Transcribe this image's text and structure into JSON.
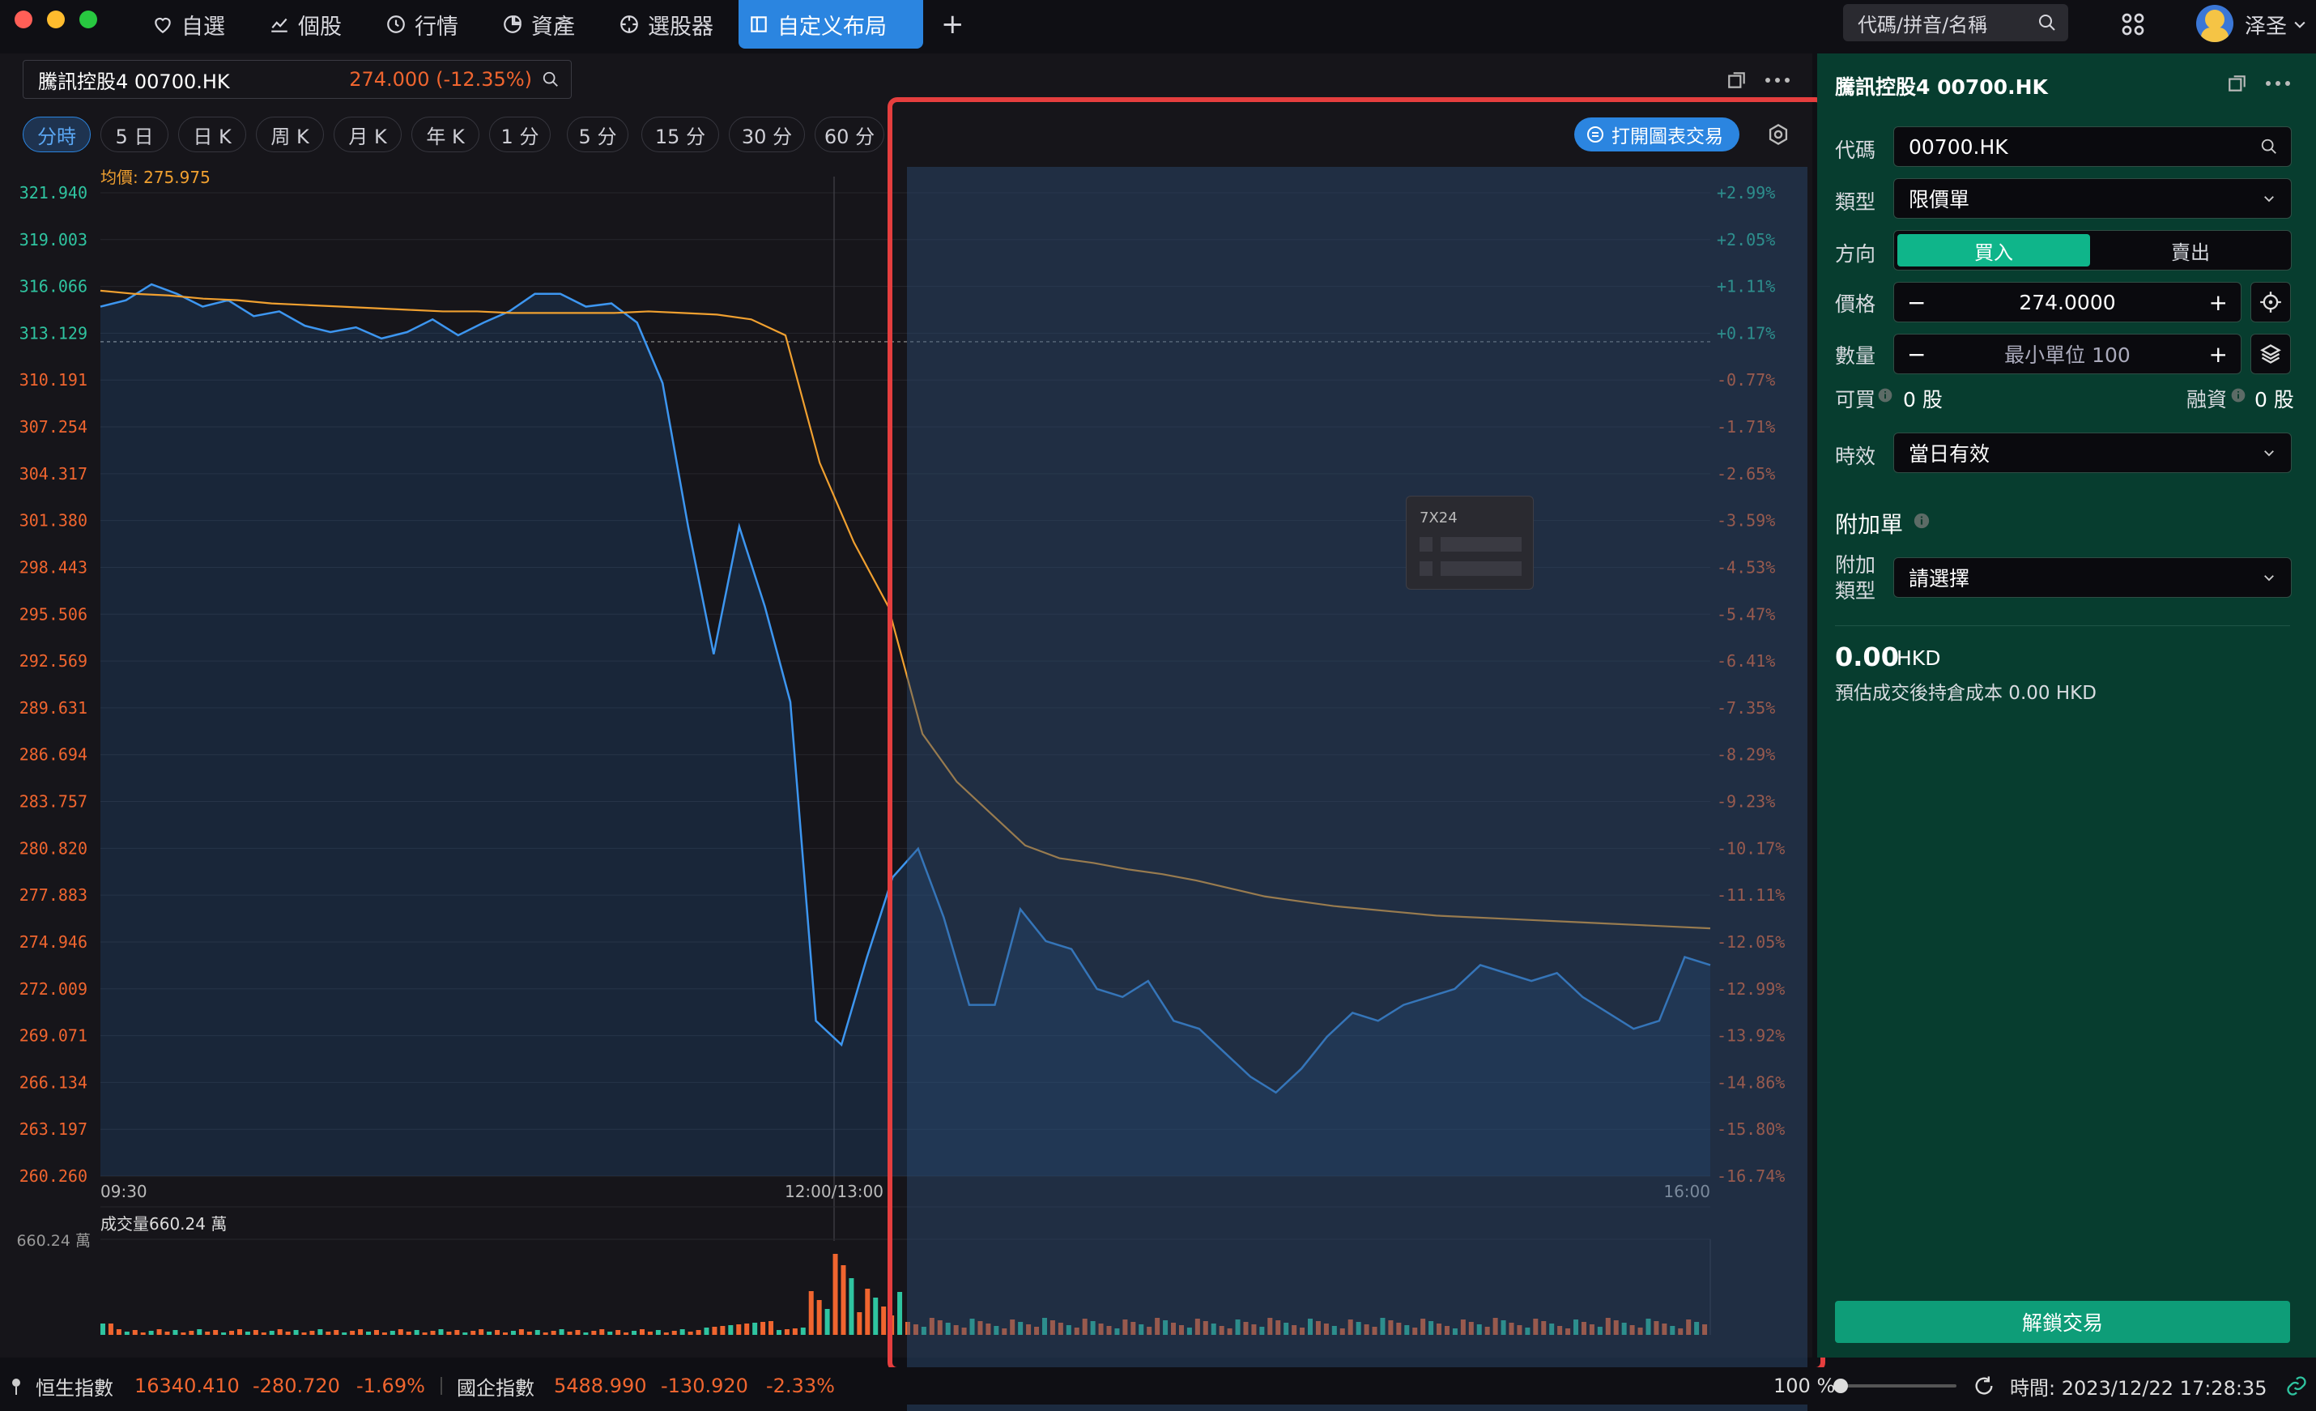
{
  "nav": {
    "tabs": [
      {
        "label": "自選"
      },
      {
        "label": "個股"
      },
      {
        "label": "行情"
      },
      {
        "label": "資產"
      },
      {
        "label": "選股器"
      },
      {
        "label": "自定义布局"
      }
    ],
    "add": "+",
    "search_placeholder": "代碼/拼音/名稱",
    "user": "泽圣"
  },
  "stock": {
    "name": "騰訊控股4 00700.HK",
    "price": "274.000 (-12.35%)"
  },
  "period_tabs": [
    "分時",
    "5 日",
    "日 K",
    "周 K",
    "月 K",
    "年 K",
    "1 分",
    "5 分",
    "15 分",
    "30 分",
    "60 分"
  ],
  "chart_data": {
    "type": "line",
    "avg_label": "均價: 275.975",
    "price_ticks": [
      "321.940",
      "319.003",
      "316.066",
      "313.129",
      "310.191",
      "307.254",
      "304.317",
      "301.380",
      "298.443",
      "295.506",
      "292.569",
      "289.631",
      "286.694",
      "283.757",
      "280.820",
      "277.883",
      "274.946",
      "272.009",
      "269.071",
      "266.134",
      "263.197",
      "260.260"
    ],
    "pct_ticks": [
      "+2.99%",
      "+2.05%",
      "+1.11%",
      "+0.17%",
      "-0.77%",
      "-1.71%",
      "-2.65%",
      "-3.59%",
      "-4.53%",
      "-5.47%",
      "-6.41%",
      "-7.35%",
      "-8.29%",
      "-9.23%",
      "-10.17%",
      "-11.11%",
      "-12.05%",
      "-12.99%",
      "-13.92%",
      "-14.86%",
      "-15.80%",
      "-16.74%"
    ],
    "x_ticks": [
      "09:30",
      "12:00/13:00",
      "16:00"
    ],
    "ylim": [
      260.26,
      321.94
    ],
    "prev_close": 312.6,
    "series": [
      {
        "name": "價格",
        "values": [
          314.8,
          315.2,
          316.2,
          315.6,
          314.8,
          315.2,
          314.2,
          314.5,
          313.6,
          313.2,
          313.5,
          312.8,
          313.2,
          314.0,
          313.0,
          313.8,
          314.5,
          315.6,
          315.6,
          314.8,
          315.0,
          313.8,
          310.0,
          301.0,
          293.0,
          301.0,
          296.0,
          290.0,
          270.0,
          268.5,
          274.0,
          279.0,
          280.8,
          276.5,
          271.0,
          271.0,
          277.0,
          275.0,
          274.5,
          272.0,
          271.5,
          272.5,
          270.0,
          269.5,
          268.0,
          266.5,
          265.5,
          267.0,
          269.0,
          270.5,
          270.0,
          271.0,
          271.5,
          272.0,
          273.5,
          273.0,
          272.5,
          273.0,
          271.5,
          270.5,
          269.5,
          270.0,
          274.0,
          273.5
        ]
      },
      {
        "name": "均價",
        "values": [
          315.8,
          315.6,
          315.5,
          315.3,
          315.2,
          315.0,
          314.9,
          314.8,
          314.7,
          314.6,
          314.5,
          314.5,
          314.4,
          314.4,
          314.4,
          314.4,
          314.5,
          314.4,
          314.3,
          314.0,
          313.0,
          305.0,
          300.0,
          296.0,
          288.0,
          285.0,
          283.0,
          281.0,
          280.2,
          279.9,
          279.5,
          279.2,
          278.8,
          278.3,
          277.8,
          277.5,
          277.2,
          277.0,
          276.8,
          276.6,
          276.5,
          276.4,
          276.3,
          276.2,
          276.1,
          276.0,
          275.9,
          275.8
        ]
      }
    ],
    "volume_label": "成交量660.24 萬",
    "volume_max": "660.24 萬"
  },
  "chart_overlay": {
    "open_trade": "打開圖表交易",
    "widget_title": "7X24"
  },
  "trade": {
    "header": "騰訊控股4 00700.HK",
    "code_label": "代碼",
    "code_value": "00700.HK",
    "type_label": "類型",
    "type_value": "限價單",
    "direction_label": "方向",
    "buy": "買入",
    "sell": "賣出",
    "price_label": "價格",
    "price_value": "274.0000",
    "qty_label": "數量",
    "qty_placeholder": "最小單位 100",
    "minus": "−",
    "plus": "+",
    "buyable_label": "可買",
    "buyable_value": "0 股",
    "margin_label": "融資",
    "margin_value": "0 股",
    "tif_label": "時效",
    "tif_value": "當日有效",
    "addon_title": "附加單",
    "addon_type_label": "附加類型",
    "addon_type_value": "請選擇",
    "amount": "0.00",
    "currency": "HKD",
    "est_cost": "預估成交後持倉成本 0.00 HKD",
    "unlock": "解鎖交易"
  },
  "bottom": {
    "idx1_name": "恒生指數",
    "idx1_value": "16340.410",
    "idx1_change": "-280.720",
    "idx1_pct": "-1.69%",
    "idx2_name": "國企指數",
    "idx2_value": "5488.990",
    "idx2_change": "-130.920",
    "idx2_pct": "-2.33%",
    "zoom": "100 %",
    "time": "時間: 2023/12/22 17:28:35"
  }
}
